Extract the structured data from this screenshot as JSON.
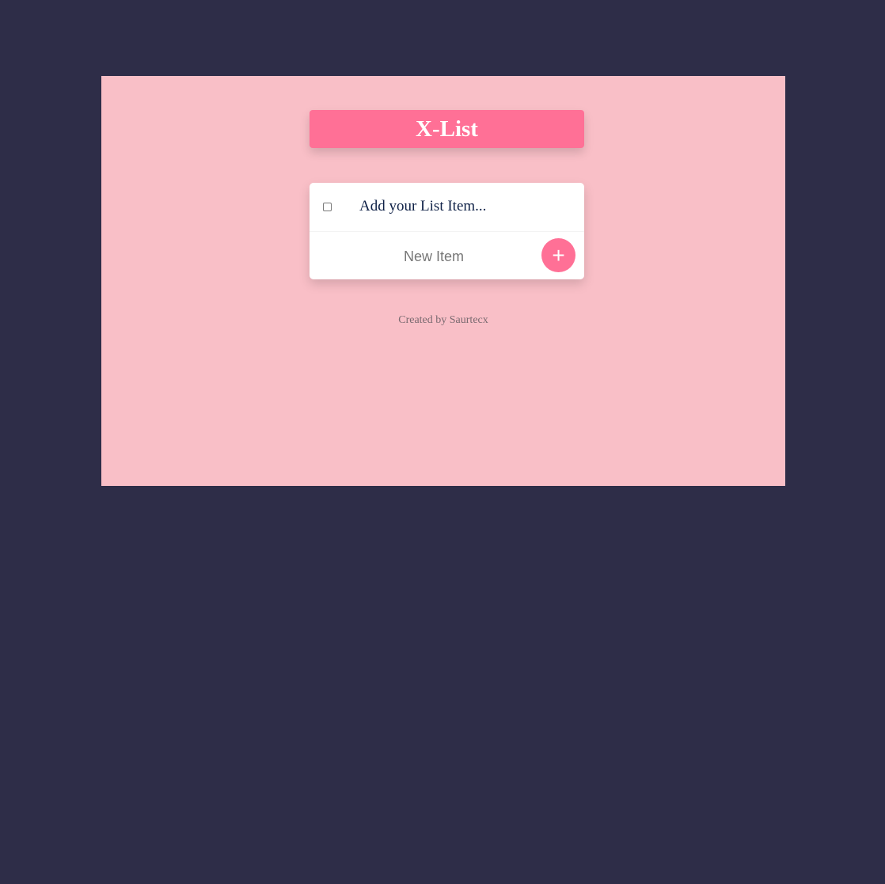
{
  "header": {
    "title": "X-List"
  },
  "list": {
    "items": [
      {
        "label": "Add your List Item...",
        "checked": false
      }
    ]
  },
  "new_item": {
    "placeholder": "New Item",
    "value": "",
    "add_button": "+"
  },
  "footer": {
    "text": "Created by Saurtecx"
  },
  "colors": {
    "page_bg": "#2e2d48",
    "app_bg": "#f9bfc7",
    "accent": "#ff7096"
  }
}
